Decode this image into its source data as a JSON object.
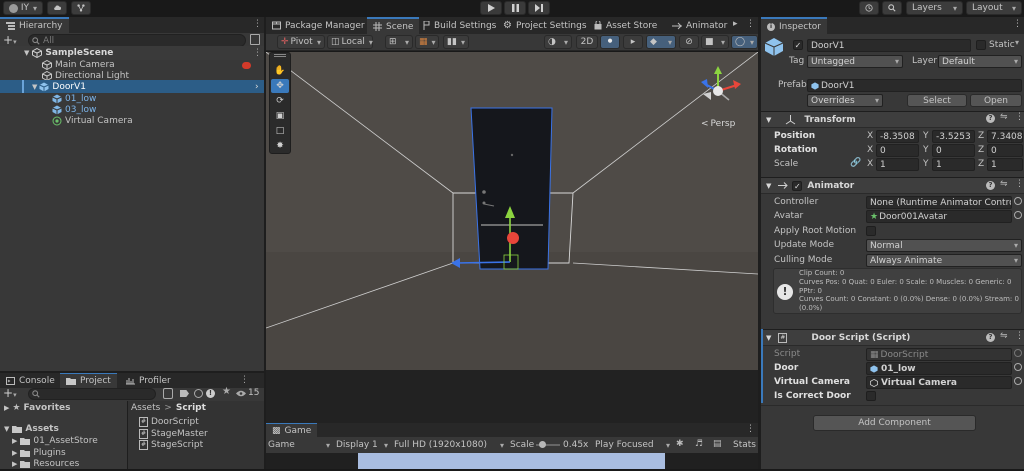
{
  "topbar": {
    "account": "IY",
    "layers": "Layers",
    "layout": "Layout"
  },
  "hierarchy": {
    "title": "Hierarchy",
    "search_placeholder": "All",
    "scene": "SampleScene",
    "items": [
      "Main Camera",
      "Directional Light",
      "DoorV1",
      "01_low",
      "03_low",
      "Virtual Camera"
    ]
  },
  "scene_tabs": [
    "Package Manager",
    "Scene",
    "Build Settings",
    "Project Settings",
    "Asset Store",
    "Animator"
  ],
  "scene_toolbar": {
    "pivot": "Pivot",
    "local": "Local",
    "mode_2d": "2D",
    "persp": "Persp"
  },
  "game": {
    "tab": "Game",
    "mode": "Game",
    "display": "Display 1",
    "resolution": "Full HD (1920x1080)",
    "scale_label": "Scale",
    "scale_value": "0.45x",
    "scale_fraction": 0.2,
    "play_focused": "Play Focused",
    "stats": "Stats"
  },
  "project": {
    "tabs": [
      "Console",
      "Project",
      "Profiler"
    ],
    "hidden_count": "15",
    "favorites": "Favorites",
    "breadcrumb_root": "Assets",
    "breadcrumb_sep": ">",
    "breadcrumb_leaf": "Script",
    "tree": [
      "Assets",
      "01_AssetStore",
      "Plugins",
      "Resources"
    ],
    "files": [
      "DoorScript",
      "StageMaster",
      "StageScript"
    ]
  },
  "inspector": {
    "title": "Inspector",
    "object_name": "DoorV1",
    "static_label": "Static",
    "tag_label": "Tag",
    "tag_value": "Untagged",
    "layer_label": "Layer",
    "layer_value": "Default",
    "prefab_label": "Prefab",
    "prefab_value": "DoorV1",
    "overrides": "Overrides",
    "select": "Select",
    "open": "Open",
    "transform": {
      "title": "Transform",
      "position_label": "Position",
      "rotation_label": "Rotation",
      "scale_label": "Scale",
      "position": [
        "-8.3508",
        "-3.5253",
        "7.34080"
      ],
      "rotation": [
        "0",
        "0",
        "0"
      ],
      "scale": [
        "1",
        "1",
        "1"
      ]
    },
    "animator": {
      "title": "Animator",
      "controller_label": "Controller",
      "controller_value": "None (Runtime Animator Controller)",
      "avatar_label": "Avatar",
      "avatar_value": "Door001Avatar",
      "root_motion_label": "Apply Root Motion",
      "update_mode_label": "Update Mode",
      "update_mode_value": "Normal",
      "culling_mode_label": "Culling Mode",
      "culling_mode_value": "Always Animate",
      "info": [
        "Clip Count: 0",
        "Curves Pos: 0 Quat: 0 Euler: 0 Scale: 0 Muscles: 0 Generic: 0",
        "PPtr: 0",
        "Curves Count: 0 Constant: 0 (0.0%) Dense: 0 (0.0%) Stream: 0",
        "(0.0%)"
      ]
    },
    "door_script": {
      "title": "Door Script (Script)",
      "script_label": "Script",
      "script_value": "DoorScript",
      "door_label": "Door",
      "door_value": "01_low",
      "camera_label": "Virtual Camera",
      "camera_value": "Virtual Camera",
      "correct_label": "Is Correct Door"
    },
    "add_component": "Add Component"
  },
  "colors": {
    "accent": "#3a79bb",
    "selection": "#2c5d87",
    "y_axis": "#8cd440",
    "x_axis": "#e8463a",
    "z_axis": "#3a73e8"
  }
}
